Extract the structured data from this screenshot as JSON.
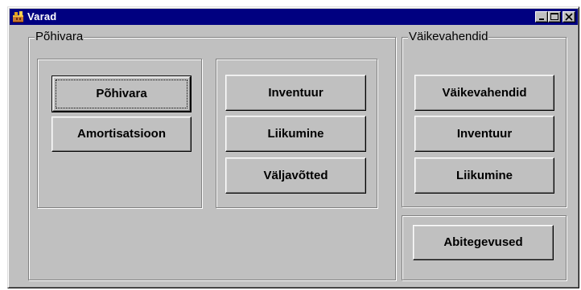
{
  "window": {
    "title": "Varad"
  },
  "titlebar_buttons": {
    "minimize_icon": "minimize-icon",
    "maximize_icon": "maximize-icon",
    "close_icon": "close-icon"
  },
  "pohivara_group": {
    "label": "Põhivara",
    "buttons": {
      "pohivara": "Põhivara",
      "amortisatsioon": "Amortisatsioon",
      "inventuur": "Inventuur",
      "liikumine": "Liikumine",
      "valjavotted": "Väljavõtted"
    }
  },
  "vaikevahendid_group": {
    "label": "Väikevahendid",
    "buttons": {
      "vaikevahendid": "Väikevahendid",
      "inventuur": "Inventuur",
      "liikumine": "Liikumine"
    }
  },
  "other": {
    "abitegevused": "Abitegevused"
  },
  "colors": {
    "titlebar": "#000080",
    "face": "#c0c0c0"
  }
}
